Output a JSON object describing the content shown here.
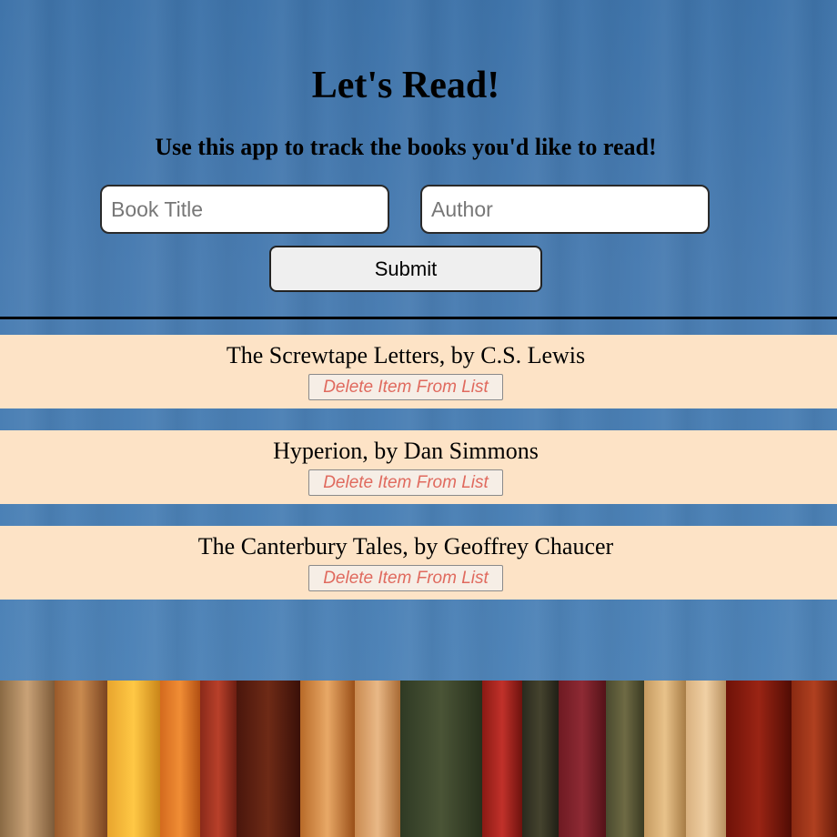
{
  "header": {
    "title": "Let's Read!",
    "subtitle": "Use this app to track the books you'd like to read!"
  },
  "form": {
    "title_placeholder": "Book Title",
    "author_placeholder": "Author",
    "title_value": "",
    "author_value": "",
    "submit_label": "Submit"
  },
  "books": [
    {
      "text": "The Screwtape Letters, by C.S. Lewis",
      "delete_label": "Delete Item From List"
    },
    {
      "text": "Hyperion, by Dan Simmons",
      "delete_label": "Delete Item From List"
    },
    {
      "text": "The Canterbury Tales, by Geoffrey Chaucer",
      "delete_label": "Delete Item From List"
    }
  ],
  "colors": {
    "background_blue": "#4579ad",
    "list_item_bg": "#fde3c6",
    "delete_text": "#e06a5e"
  }
}
